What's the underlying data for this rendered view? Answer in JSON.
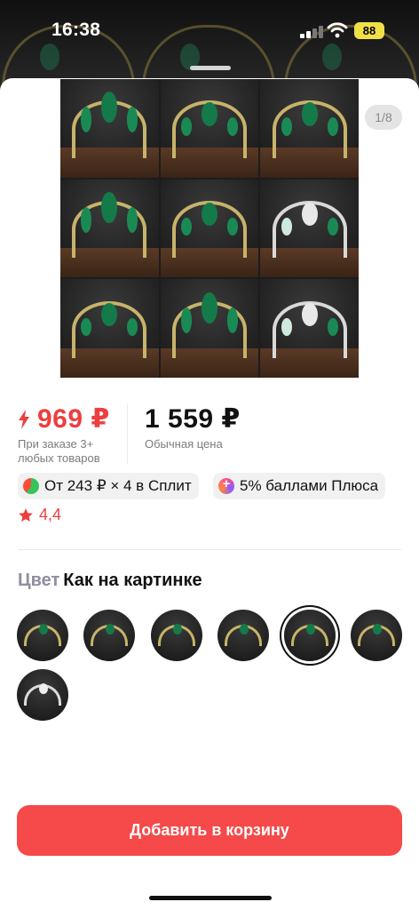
{
  "status_bar": {
    "time": "16:38",
    "battery": "88"
  },
  "gallery": {
    "counter": "1/8"
  },
  "price": {
    "current": "969 ₽",
    "current_note": "При заказе 3+ любых товаров",
    "regular": "1 559 ₽",
    "regular_note": "Обычная цена"
  },
  "offers": {
    "split": "От 243 ₽ × 4 в Сплит",
    "plus": "5% баллами Плюса"
  },
  "rating": {
    "value": "4,4"
  },
  "color": {
    "label": "Цвет",
    "value": "Как на картинке",
    "selected_index": 5
  },
  "actions": {
    "add_to_cart": "Добавить в корзину"
  },
  "colors": {
    "accent": "#f64949",
    "price_red": "#ee3e3e"
  }
}
